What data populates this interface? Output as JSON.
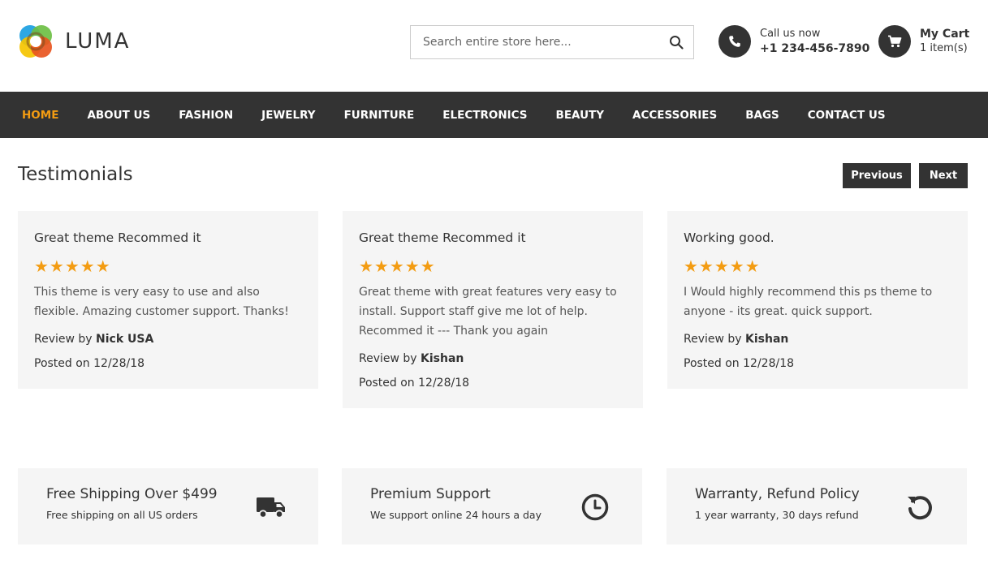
{
  "brand": {
    "name": "LUMA",
    "colors": [
      "#1ba0e1",
      "#6cbf44",
      "#f5a623",
      "#e8551f"
    ]
  },
  "search": {
    "placeholder": "Search entire store here..."
  },
  "call": {
    "label": "Call us now",
    "phone": "+1 234-456-7890"
  },
  "cart": {
    "title": "My Cart",
    "count": "1 item(s)"
  },
  "nav": {
    "items": [
      {
        "label": "HOME",
        "active": true
      },
      {
        "label": "ABOUT US"
      },
      {
        "label": "FASHION"
      },
      {
        "label": "JEWELRY"
      },
      {
        "label": "FURNITURE"
      },
      {
        "label": "ELECTRONICS"
      },
      {
        "label": "BEAUTY"
      },
      {
        "label": "ACCESSORIES"
      },
      {
        "label": "BAGS"
      },
      {
        "label": "CONTACT US"
      }
    ],
    "active_color": "#f39c12"
  },
  "testimonials": {
    "title": "Testimonials",
    "prev_label": "Previous",
    "next_label": "Next",
    "review_prefix": "Review by",
    "stars": "★★★★★",
    "items": [
      {
        "title": "Great theme Recommed it",
        "rating": 5,
        "body": "This theme is very easy to use and also flexible. Amazing customer support. Thanks!",
        "author": "Nick USA",
        "posted": "Posted on 12/28/18"
      },
      {
        "title": "Great theme Recommed it",
        "rating": 5,
        "body": "Great theme with great features very easy to install. Support staff give me lot of help. Recommed it --- Thank you again",
        "author": "Kishan",
        "posted": "Posted on 12/28/18"
      },
      {
        "title": "Working good.",
        "rating": 5,
        "body": "I Would highly recommend this ps theme to anyone - its great. quick support.",
        "author": "Kishan",
        "posted": "Posted on 12/28/18"
      }
    ]
  },
  "features": [
    {
      "title": "Free Shipping Over $499",
      "subtitle": "Free shipping on all US orders",
      "icon": "truck-icon"
    },
    {
      "title": "Premium Support",
      "subtitle": "We support online 24 hours a day",
      "icon": "clock-icon"
    },
    {
      "title": "Warranty, Refund Policy",
      "subtitle": "1 year warranty, 30 days refund",
      "icon": "refund-icon"
    }
  ]
}
